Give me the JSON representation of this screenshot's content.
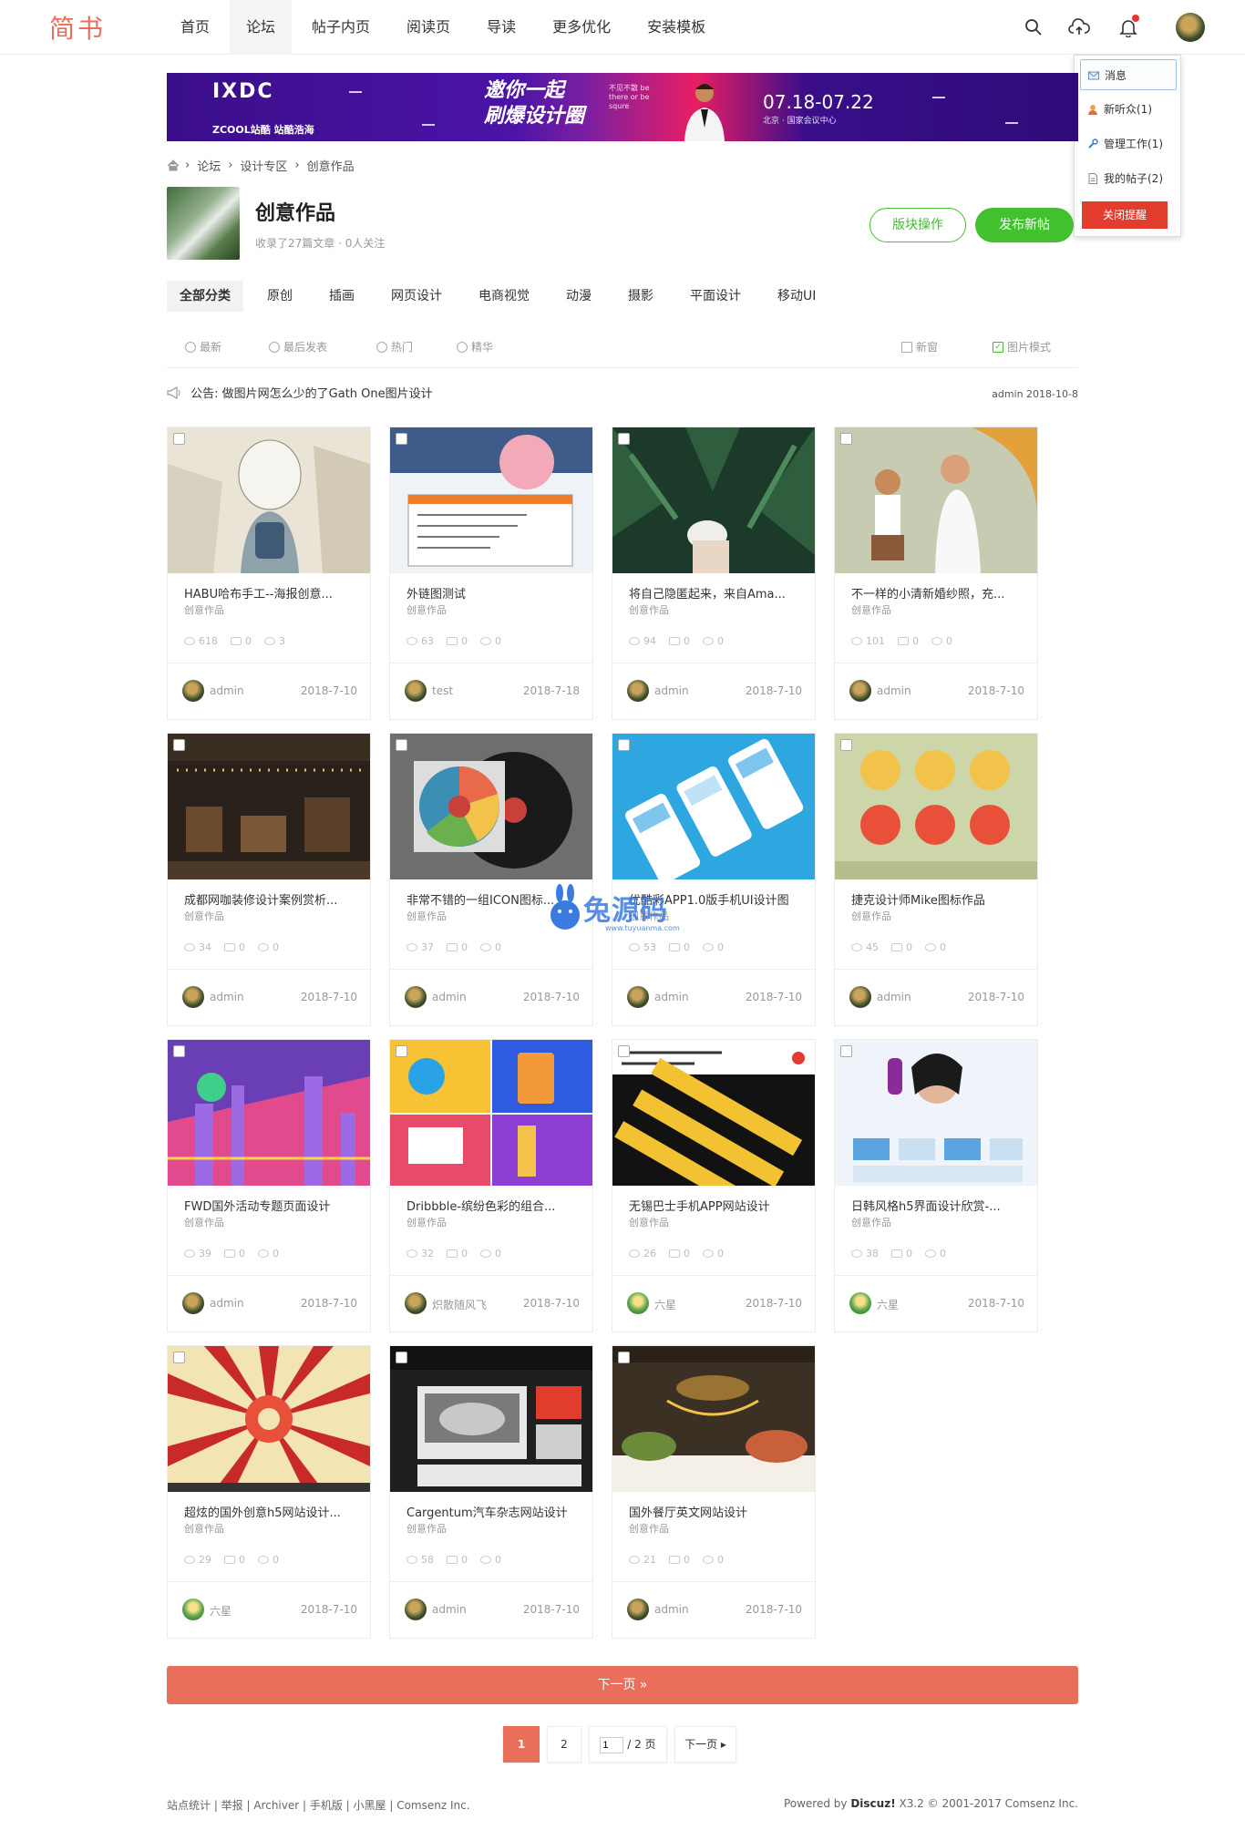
{
  "header": {
    "logo": "简书",
    "nav": [
      "首页",
      "论坛",
      "帖子内页",
      "阅读页",
      "导读",
      "更多优化",
      "安装模板"
    ],
    "active_nav": 1
  },
  "dropdown": {
    "items": [
      "消息",
      "新听众(1)",
      "管理工作(1)",
      "我的帖子(2)"
    ],
    "close_label": "关闭提醒"
  },
  "banner": {
    "logo": "IXDC",
    "logo_sub": "ZCOOL站酷  站酷浩海",
    "slogan_line1": "邀你一起",
    "slogan_line2": "刷爆设计圈",
    "slogan_en": "不见不散 be there or be squre",
    "date": "07.18-07.22",
    "place": "北京 · 国家会议中心"
  },
  "breadcrumb": [
    "论坛",
    "设计专区",
    "创意作品"
  ],
  "forum": {
    "title": "创意作品",
    "stats": "收录了27篇文章 · 0人关注",
    "btn_manage": "版块操作",
    "btn_post": "发布新帖"
  },
  "categories": [
    "全部分类",
    "原创",
    "插画",
    "网页设计",
    "电商视觉",
    "动漫",
    "摄影",
    "平面设计",
    "移动UI"
  ],
  "filters": {
    "left": [
      "最新",
      "最后发表",
      "热门",
      "精华"
    ],
    "new_window": "新窗",
    "image_mode": "图片模式"
  },
  "notice": {
    "text": "公告: 做图片网怎么少的了Gath One图片设计",
    "author_date": "admin 2018-10-8"
  },
  "cards": [
    {
      "title": "HABU哈布手工--海报创意...",
      "category": "创意作品",
      "views": "618",
      "likes": "0",
      "replies": "3",
      "user": "admin",
      "date": "2018-7-10"
    },
    {
      "title": "外链图测试",
      "category": "创意作品",
      "views": "63",
      "likes": "0",
      "replies": "0",
      "user": "test",
      "date": "2018-7-18"
    },
    {
      "title": "将自己隐匿起来，来自Ama...",
      "category": "创意作品",
      "views": "94",
      "likes": "0",
      "replies": "0",
      "user": "admin",
      "date": "2018-7-10"
    },
    {
      "title": "不一样的小清新婚纱照，充...",
      "category": "创意作品",
      "views": "101",
      "likes": "0",
      "replies": "0",
      "user": "admin",
      "date": "2018-7-10"
    },
    {
      "title": "成都网咖装修设计案例赏析...",
      "category": "创意作品",
      "views": "34",
      "likes": "0",
      "replies": "0",
      "user": "admin",
      "date": "2018-7-10"
    },
    {
      "title": "非常不错的一组ICON图标...",
      "category": "创意作品",
      "views": "37",
      "likes": "0",
      "replies": "0",
      "user": "admin",
      "date": "2018-7-10"
    },
    {
      "title": "优酷彩APP1.0版手机UI设计图",
      "category": "创意作品",
      "views": "53",
      "likes": "0",
      "replies": "0",
      "user": "admin",
      "date": "2018-7-10"
    },
    {
      "title": "捷克设计师Mike图标作品",
      "category": "创意作品",
      "views": "45",
      "likes": "0",
      "replies": "0",
      "user": "admin",
      "date": "2018-7-10"
    },
    {
      "title": "FWD国外活动专题页面设计",
      "category": "创意作品",
      "views": "39",
      "likes": "0",
      "replies": "0",
      "user": "admin",
      "date": "2018-7-10"
    },
    {
      "title": "Dribbble-缤纷色彩的组合...",
      "category": "创意作品",
      "views": "32",
      "likes": "0",
      "replies": "0",
      "user": "炽散随风飞",
      "date": "2018-7-10"
    },
    {
      "title": "无锡巴士手机APP网站设计",
      "category": "创意作品",
      "views": "26",
      "likes": "0",
      "replies": "0",
      "user": "六星",
      "date": "2018-7-10"
    },
    {
      "title": "日韩风格h5界面设计欣赏-...",
      "category": "创意作品",
      "views": "38",
      "likes": "0",
      "replies": "0",
      "user": "六星",
      "date": "2018-7-10"
    },
    {
      "title": "超炫的国外创意h5网站设计...",
      "category": "创意作品",
      "views": "29",
      "likes": "0",
      "replies": "0",
      "user": "六星",
      "date": "2018-7-10"
    },
    {
      "title": "Cargentum汽车杂志网站设计",
      "category": "创意作品",
      "views": "58",
      "likes": "0",
      "replies": "0",
      "user": "admin",
      "date": "2018-7-10"
    },
    {
      "title": "国外餐厅英文网站设计",
      "category": "创意作品",
      "views": "21",
      "likes": "0",
      "replies": "0",
      "user": "admin",
      "date": "2018-7-10"
    }
  ],
  "pager": {
    "next_bar": "下一页 »",
    "current": "1",
    "page2": "2",
    "jump_value": "1",
    "total": "/ 2 页",
    "next": "下一页 ▸"
  },
  "watermark": {
    "text": "兔源码",
    "sub": "www.tuyuanma.com"
  },
  "footer": {
    "left": "站点统计 | 举报 | Archiver | 手机版 | 小黑屋 | Comsenz Inc.",
    "powered": "Powered by",
    "brand": "Discuz!",
    "version": "X3.2  © 2001-2017 Comsenz Inc."
  }
}
